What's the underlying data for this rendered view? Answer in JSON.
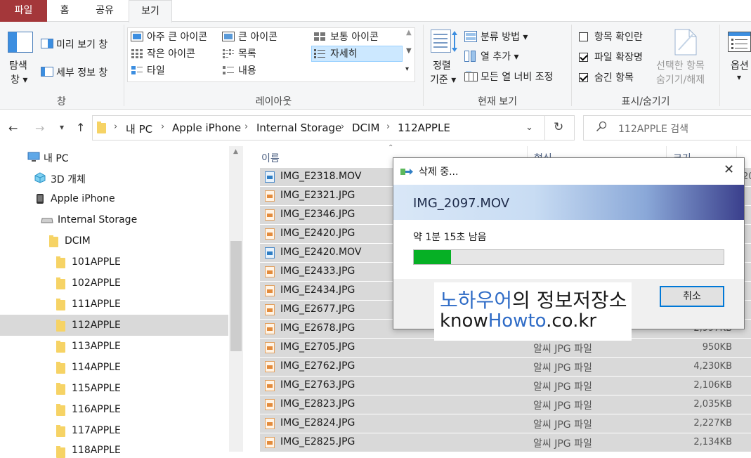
{
  "ribbon_tabs": {
    "file": "파일",
    "home": "홈",
    "share": "공유",
    "view": "보기"
  },
  "pane_group": {
    "nav_pane_line1": "탐색",
    "nav_pane_line2": "창",
    "preview": "미리 보기 창",
    "details": "세부 정보 창",
    "group_label": "창"
  },
  "layout_group": {
    "extra_large": "아주 큰 아이콘",
    "large": "큰 아이콘",
    "medium": "보통 아이콘",
    "small": "작은 아이콘",
    "list": "목록",
    "details": "자세히",
    "tiles": "타일",
    "content": "내용",
    "group_label": "레이아웃"
  },
  "current_view_group": {
    "sort_line1": "정렬",
    "sort_line2": "기준",
    "group_by": "분류 방법",
    "add_column": "열 추가",
    "fit_columns": "모든 열 너비 조정",
    "group_label": "현재 보기"
  },
  "show_hide_group": {
    "item_checkboxes": "항목 확인란",
    "item_checkboxes_checked": false,
    "file_extensions": "파일 확장명",
    "file_extensions_checked": true,
    "hidden_items": "숨긴 항목",
    "hidden_items_checked": true,
    "hide_selected_line1": "선택한 항목",
    "hide_selected_line2": "숨기기/해제",
    "group_label": "표시/숨기기"
  },
  "options": {
    "label": "옵션"
  },
  "address": {
    "crumbs": [
      "내 PC",
      "Apple iPhone",
      "Internal Storage",
      "DCIM",
      "112APPLE"
    ]
  },
  "search": {
    "placeholder": "112APPLE 검색"
  },
  "nav_tree": [
    "내 PC",
    "3D 개체",
    "Apple iPhone",
    "Internal Storage",
    "DCIM",
    "101APPLE",
    "102APPLE",
    "111APPLE",
    "112APPLE",
    "113APPLE",
    "114APPLE",
    "115APPLE",
    "116APPLE",
    "117APPLE",
    "118APPLE"
  ],
  "columns": {
    "name": "이름",
    "type": "형식",
    "size": "크기"
  },
  "files": [
    {
      "name": "IMG_E2318.MOV",
      "type": "",
      "size": ""
    },
    {
      "name": "IMG_E2321.JPG",
      "type": "",
      "size": ""
    },
    {
      "name": "IMG_E2346.JPG",
      "type": "",
      "size": ""
    },
    {
      "name": "IMG_E2420.JPG",
      "type": "",
      "size": ""
    },
    {
      "name": "IMG_E2420.MOV",
      "type": "",
      "size": ""
    },
    {
      "name": "IMG_E2433.JPG",
      "type": "",
      "size": ""
    },
    {
      "name": "IMG_E2434.JPG",
      "type": "",
      "size": ""
    },
    {
      "name": "IMG_E2677.JPG",
      "type": "",
      "size": ""
    },
    {
      "name": "IMG_E2678.JPG",
      "type": "",
      "size": "2,997KB"
    },
    {
      "name": "IMG_E2705.JPG",
      "type": "알씨 JPG 파일",
      "size": "950KB"
    },
    {
      "name": "IMG_E2762.JPG",
      "type": "알씨 JPG 파일",
      "size": "4,230KB"
    },
    {
      "name": "IMG_E2763.JPG",
      "type": "알씨 JPG 파일",
      "size": "2,106KB"
    },
    {
      "name": "IMG_E2823.JPG",
      "type": "알씨 JPG 파일",
      "size": "2,035KB"
    },
    {
      "name": "IMG_E2824.JPG",
      "type": "알씨 JPG 파일",
      "size": "2,227KB"
    },
    {
      "name": "IMG_E2825.JPG",
      "type": "알씨 JPG 파일",
      "size": "2,134KB"
    }
  ],
  "right_edge_digit": "20",
  "dialog": {
    "title": "삭제 중...",
    "filename": "IMG_2097.MOV",
    "time_remaining": "약 1분 15초 남음",
    "progress": 0.12,
    "cancel": "취소"
  },
  "watermark": {
    "line1_blue": "노하우어",
    "line1_black": "의 정보저장소",
    "line2_a": "know",
    "line2_b": "Howto",
    "line2_c": ".co.kr"
  },
  "colors": {
    "file_tab": "#a4373a",
    "progress": "#06b025",
    "selection": "#d9d9d9",
    "accent": "#0078d7",
    "watermark_blue": "#2e6bc6"
  }
}
